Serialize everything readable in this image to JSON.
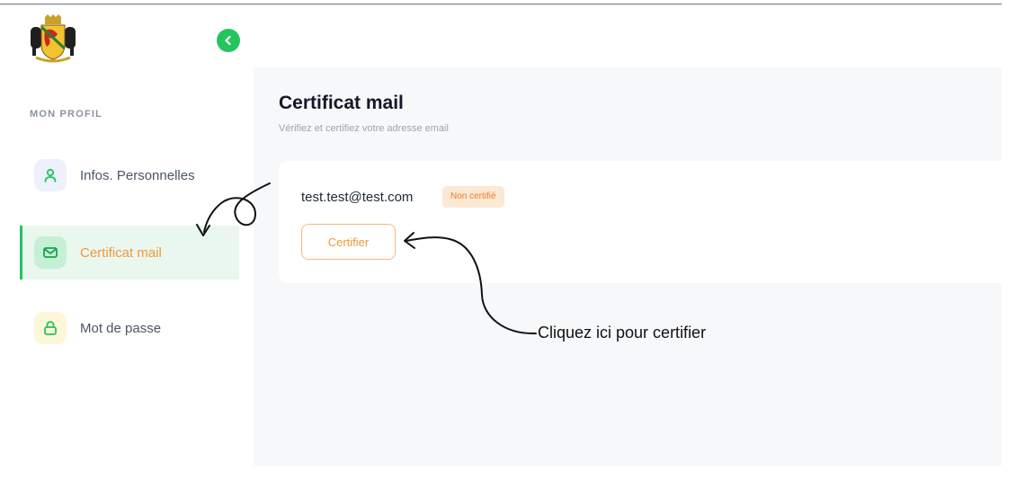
{
  "sidebar": {
    "section_label": "MON PROFIL",
    "items": [
      {
        "label": "Infos. Personnelles",
        "icon": "user-icon",
        "active": false
      },
      {
        "label": "Certificat mail",
        "icon": "mail-icon",
        "active": true
      },
      {
        "label": "Mot de passe",
        "icon": "lock-icon",
        "active": false
      }
    ]
  },
  "header": {
    "logo": "coat-of-arms-logo",
    "collapse_icon": "chevron-left-icon"
  },
  "page": {
    "title": "Certificat mail",
    "subtitle": "Vérifiez et certifiez votre adresse email"
  },
  "card": {
    "email": "test.test@test.com",
    "status_badge": "Non certifié",
    "certify_button": "Certifier"
  },
  "annotation": {
    "hint": "Cliquez ici pour certifier"
  },
  "colors": {
    "accent_green": "#22c55e",
    "accent_orange": "#f0993a",
    "badge_bg": "#fde8d4",
    "active_bg": "#e9f7ee"
  }
}
